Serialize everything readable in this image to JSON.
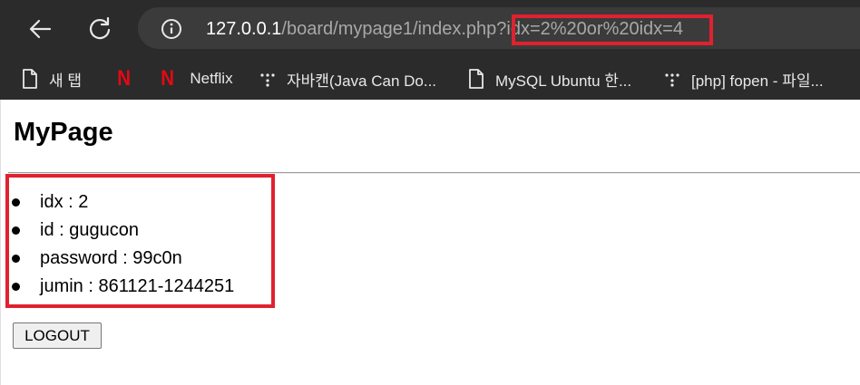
{
  "browser": {
    "url": {
      "host": "127.0.0.1",
      "path": "/board/mypage1/index.php?",
      "query": "idx=2%20or%20idx=4"
    },
    "bookmarks": [
      {
        "label": "새 탭",
        "icon": "page-icon"
      },
      {
        "label": "",
        "icon": "netflix-icon"
      },
      {
        "label": "Netflix",
        "icon": "netflix-icon"
      },
      {
        "label": "자바캔(Java Can Do...",
        "icon": "dots-icon"
      },
      {
        "label": "MySQL Ubuntu 한...",
        "icon": "page-icon"
      },
      {
        "label": "[php] fopen - 파일...",
        "icon": "dots-icon"
      }
    ],
    "netflix_glyph": "N",
    "colors": {
      "chrome": "#2b2b2b",
      "omnibox": "#3b3b3b",
      "highlight": "#e0212f",
      "netflix": "#e50914"
    }
  },
  "page": {
    "title": "MyPage",
    "user_info": [
      {
        "text": "idx : 2"
      },
      {
        "text": "id : gugucon"
      },
      {
        "text": "password : 99c0n"
      },
      {
        "text": "jumin : 861121-1244251"
      }
    ],
    "logout_label": "LOGOUT"
  }
}
